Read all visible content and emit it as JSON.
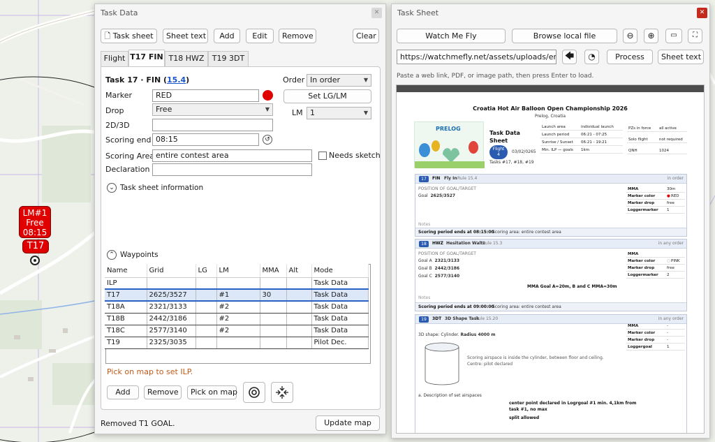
{
  "map": {
    "marker_lm_lines": [
      "LM#1",
      "Free",
      "08:15"
    ],
    "marker_t17": "T17",
    "colors": {
      "marker": "#e00000",
      "road": "#ffffff",
      "grid": "#c9b8e6",
      "water": "#5b8cd6"
    }
  },
  "task_window": {
    "title": "Task Data",
    "close_icon": "close-icon",
    "toolbar": {
      "task_sheet": "Task sheet",
      "sheet_text": "Sheet text",
      "add": "Add",
      "edit": "Edit",
      "remove": "Remove",
      "clear": "Clear"
    },
    "tabs": [
      "Flight",
      "T17 FIN",
      "T18 HWZ",
      "T19 3DT"
    ],
    "active_tab": 1,
    "task_heading": "Task 17 · FIN (",
    "task_rule_link": "15.4",
    "task_heading_end": ")",
    "order_label": "Order",
    "order_value": "In order",
    "marker_label": "Marker",
    "marker_value": "RED",
    "marker_color": "#e00000",
    "set_lg_lm": "Set LG/LM",
    "drop_label": "Drop",
    "drop_value": "Free",
    "lm_label": "LM",
    "lm_value": "1",
    "dim_label": "2D/3D",
    "dim_value": "",
    "scoring_end_label": "Scoring end",
    "scoring_end_value": "08:15",
    "scoring_area_label": "Scoring Area",
    "scoring_area_value": "entire contest area",
    "needs_sketch": "Needs sketch",
    "declaration_label": "Declaration",
    "declaration_value": "",
    "task_sheet_info": "Task sheet information",
    "waypoints_label": "Waypoints",
    "columns": [
      "Name",
      "Grid",
      "LG",
      "LM",
      "MMA",
      "Alt",
      "Mode"
    ],
    "rows": [
      [
        "ILP",
        "",
        "",
        "",
        "",
        "",
        "Task Data"
      ],
      [
        "T17",
        "2625/3527",
        "",
        "#1",
        "30",
        "",
        "Task Data"
      ],
      [
        "T18A",
        "2321/3133",
        "",
        "#2",
        "",
        "",
        "Task Data"
      ],
      [
        "T18B",
        "2442/3186",
        "",
        "#2",
        "",
        "",
        "Task Data"
      ],
      [
        "T18C",
        "2577/3140",
        "",
        "#2",
        "",
        "",
        "Task Data"
      ],
      [
        "T19",
        "2325/3035",
        "",
        "",
        "",
        "",
        "Pilot Dec."
      ]
    ],
    "selected_row": 1,
    "hint": "Pick on map to set ILP.",
    "wp_add": "Add",
    "wp_remove": "Remove",
    "wp_pick": "Pick on map",
    "status": "Removed T1 GOAL.",
    "update_map": "Update map"
  },
  "sheet_window": {
    "title": "Task Sheet",
    "watch_me_fly": "Watch Me Fly",
    "browse_local": "Browse local file",
    "url_value": "https://watchmefly.net/assets/uploads/enb/flight",
    "process": "Process",
    "sheet_text": "Sheet text",
    "hint": "Paste a web link, PDF, or image path, then press Enter to load.",
    "icons": [
      "zoom-out-icon",
      "zoom-in-icon",
      "fit-width-icon",
      "fit-page-icon",
      "back-arrow-icon",
      "history-icon",
      "close-icon"
    ]
  },
  "doc": {
    "title": "Croatia Hot Air Balloon Open Championship 2026",
    "location": "Prelog, Croatia",
    "logo_text": "PRELOG",
    "sheet_title_1": "Task Data",
    "sheet_title_2": "Sheet",
    "flight_badge_1": "Flight",
    "flight_badge_2": "4",
    "flight_date": "03/02/0265",
    "tasks_line": "Tasks #17, #18, #19",
    "info_left": [
      [
        "Launch area",
        "individual launch"
      ],
      [
        "Launch period",
        "06:21 - 07:25"
      ],
      [
        "Sunrise / Sunset",
        "06:21 - 19:21"
      ],
      [
        "Min. ILP — goals",
        "1km"
      ]
    ],
    "info_right": [
      [
        "PZs in force",
        "all active"
      ],
      [
        "Solo flight",
        "not required"
      ],
      [
        "QNH",
        "1024"
      ]
    ],
    "sections": [
      {
        "num": "17",
        "code": "FIN",
        "name": "Fly In",
        "rule": "Rule 15.4",
        "order": "in order",
        "pos_label": "POSITION OF GOAL/TARGET",
        "lines": [
          [
            "Goal",
            "2625/3527"
          ]
        ],
        "marks": [
          [
            "MMA",
            "30m"
          ],
          [
            "Marker color",
            "RED"
          ],
          [
            "Marker drop",
            "free"
          ],
          [
            "Loggermarker",
            "1"
          ]
        ],
        "notes_label": "Notes",
        "footer_a": "Scoring period ends at 08:15:00",
        "footer_b": "Scoring area: entire contest area"
      },
      {
        "num": "18",
        "code": "HWZ",
        "name": "Hesitation Waltz",
        "rule": "Rule 15.3",
        "order": "in any order",
        "pos_label": "POSITION OF GOAL/TARGET",
        "lines": [
          [
            "Goal A",
            "2321/3133"
          ],
          [
            "Goal B",
            "2442/3186"
          ],
          [
            "Goal C",
            "2577/3140"
          ]
        ],
        "mma_note": "MMA Goal A=20m, B and C MMA=30m",
        "marks": [
          [
            "MMA",
            ""
          ],
          [
            "Marker color",
            "PINK"
          ],
          [
            "Marker drop",
            "free"
          ],
          [
            "Loggermarker",
            "2"
          ]
        ],
        "notes_label": "Notes",
        "footer_a": "Scoring period ends at 09:00:00",
        "footer_b": "Scoring area: entire contest area"
      },
      {
        "num": "19",
        "code": "3DT",
        "name": "3D Shape Task",
        "rule": "Rule 15.20",
        "order": "in any order",
        "shape_line_a": "3D shape: Cylinder. ",
        "shape_line_b": "Radius 4000 m",
        "scoring_text_1": "Scoring airspace is inside the cylinder, between floor and ceiling.",
        "scoring_text_2": "Centre: pilot declared",
        "marks": [
          [
            "MMA",
            "-"
          ],
          [
            "Marker color",
            "-"
          ],
          [
            "Marker drop",
            "-"
          ],
          [
            "Loggergoal",
            "1"
          ]
        ],
        "desc_label": "a.  Description of set airspaces",
        "desc_1": "center point declared in Logrgoal #1 min. 4,1km from",
        "desc_2": "task #1, no max",
        "desc_3": "split allowed"
      }
    ]
  }
}
